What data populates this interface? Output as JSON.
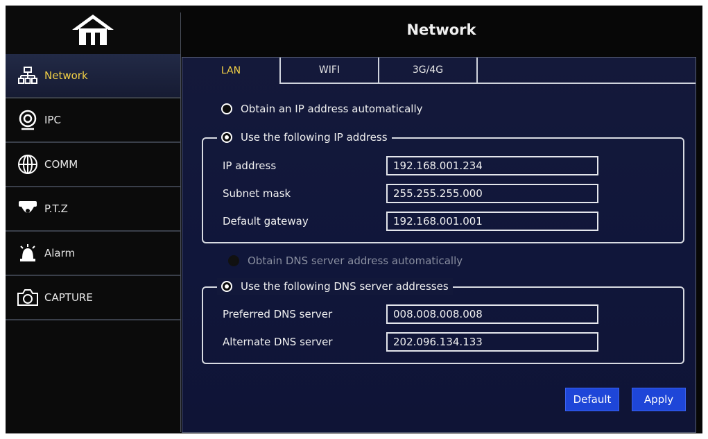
{
  "header": {
    "title": "Network"
  },
  "sidebar": {
    "home_icon": "home-icon",
    "items": [
      {
        "label": "Network",
        "icon": "network-icon",
        "active": true
      },
      {
        "label": "IPC",
        "icon": "camera-lens-icon",
        "active": false
      },
      {
        "label": "COMM",
        "icon": "globe-icon",
        "active": false
      },
      {
        "label": "P.T.Z",
        "icon": "dome-camera-icon",
        "active": false
      },
      {
        "label": "Alarm",
        "icon": "alarm-siren-icon",
        "active": false
      },
      {
        "label": "CAPTURE",
        "icon": "photo-camera-icon",
        "active": false
      }
    ]
  },
  "tabs": [
    {
      "label": "LAN",
      "active": true
    },
    {
      "label": "WIFI",
      "active": false
    },
    {
      "label": "3G/4G",
      "active": false
    }
  ],
  "ip": {
    "auto_label": "Obtain an IP address automatically",
    "manual_label": "Use the following IP address",
    "selected": "manual",
    "fields": {
      "ip_label": "IP address",
      "ip_value": "192.168.001.234",
      "mask_label": "Subnet mask",
      "mask_value": "255.255.255.000",
      "gw_label": "Default gateway",
      "gw_value": "192.168.001.001"
    }
  },
  "dns": {
    "auto_label": "Obtain DNS server address automatically",
    "manual_label": "Use the following DNS server addresses",
    "selected": "manual",
    "fields": {
      "preferred_label": "Preferred DNS server",
      "preferred_value": "008.008.008.008",
      "alternate_label": "Alternate DNS server",
      "alternate_value": "202.096.134.133"
    }
  },
  "buttons": {
    "default_label": "Default",
    "apply_label": "Apply"
  },
  "colors": {
    "accent_text": "#f3d146",
    "button": "#1e46d8",
    "panel": "#12183a"
  }
}
